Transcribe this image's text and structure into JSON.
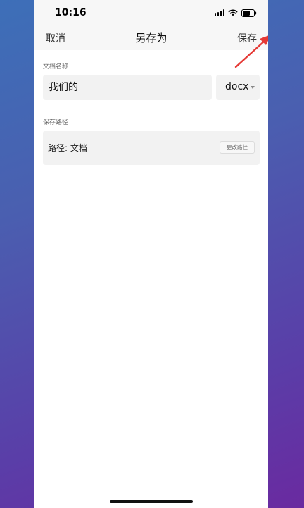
{
  "status_bar": {
    "time": "10:16"
  },
  "nav": {
    "cancel_label": "取消",
    "title": "另存为",
    "save_label": "保存"
  },
  "filename_section": {
    "label": "文档名称",
    "value": "我们的",
    "format": "docx"
  },
  "path_section": {
    "label": "保存路径",
    "path_text": "路径: 文档",
    "change_button": "更改路径"
  },
  "colors": {
    "accent_arrow": "#e53935",
    "background_top": "#3d6fb8",
    "background_bottom": "#6a2aa0"
  }
}
